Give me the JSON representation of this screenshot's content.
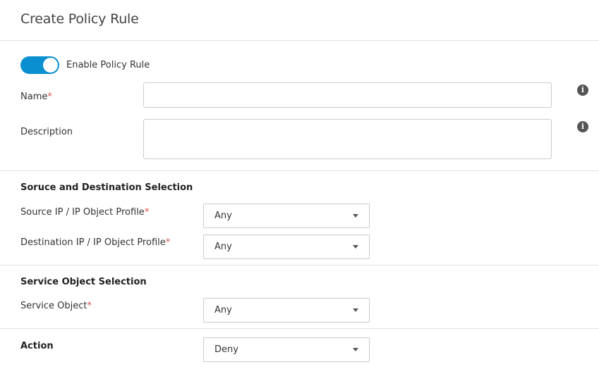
{
  "header": {
    "title": "Create Policy Rule"
  },
  "toggle": {
    "label": "Enable Policy Rule",
    "enabled": true
  },
  "fields": {
    "name": {
      "label": "Name",
      "required_mark": "*",
      "value": ""
    },
    "description": {
      "label": "Description",
      "value": ""
    }
  },
  "sections": {
    "source_destination": {
      "title": "Soruce and Destination Selection"
    },
    "service": {
      "title": "Service Object Selection"
    },
    "action": {
      "title": "Action"
    }
  },
  "selects": {
    "source": {
      "label": "Source IP / IP Object Profile",
      "required_mark": "*",
      "value": "Any"
    },
    "destination": {
      "label": "Destination IP / IP Object Profile",
      "required_mark": "*",
      "value": "Any"
    },
    "service_object": {
      "label": "Service Object",
      "required_mark": "*",
      "value": "Any"
    },
    "action": {
      "value": "Deny"
    }
  },
  "icons": {
    "info": "i"
  },
  "colors": {
    "accent": "#0a8fd1",
    "required": "#d9534f"
  }
}
